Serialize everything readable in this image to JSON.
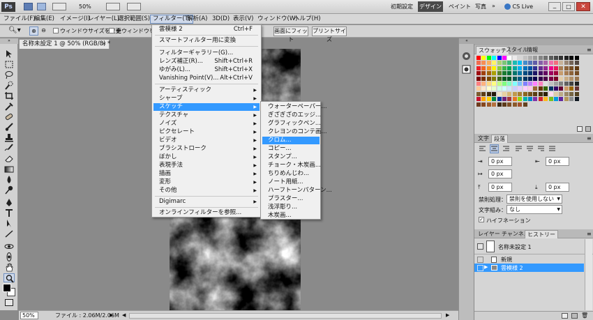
{
  "appbar": {
    "logo": "Ps",
    "zoom": "50%",
    "workspaces": [
      "初期設定",
      "デザイン",
      "ペイント",
      "写真"
    ],
    "active_workspace": "デザイン",
    "cs_live": "CS Live"
  },
  "menubar": {
    "items": [
      "ファイル(F)",
      "編集(E)",
      "イメージ(I)",
      "レイヤー(L)",
      "選択範囲(S)",
      "フィルター(T)",
      "解析(A)",
      "3D(D)",
      "表示(V)",
      "ウィンドウ(W)",
      "ヘルプ(H)"
    ],
    "active": "フィルター(T)"
  },
  "options": {
    "resize_windows": "ウィンドウサイズを変更",
    "all_windows": "全ウィンドウをズー",
    "fit_screen": "画面にフィット",
    "print_size": "プリントサイズ"
  },
  "document": {
    "tab_title": "名称未設定 1 @ 50% (RGB/8) *",
    "status_zoom": "50%",
    "status_info": "ファイル : 2.06M/2.06M"
  },
  "filter_menu": {
    "last_filter": "雲模様 2",
    "last_filter_shortcut": "Ctrl+F",
    "smart_filter": "スマートフィルター用に変換",
    "gallery": "フィルターギャラリー(G)...",
    "lens": "レンズ補正(R)...",
    "lens_shortcut": "Shift+Ctrl+R",
    "liquify": "ゆがみ(L)...",
    "liquify_shortcut": "Shift+Ctrl+X",
    "vanishing": "Vanishing Point(V)...",
    "vanishing_shortcut": "Alt+Ctrl+V",
    "submenus": [
      "アーティスティック",
      "シャープ",
      "スケッチ",
      "テクスチャ",
      "ノイズ",
      "ピクセレート",
      "ビデオ",
      "ブラシストローク",
      "ぼかし",
      "表現手法",
      "描画",
      "変形",
      "その他"
    ],
    "highlighted": "スケッチ",
    "digimarc": "Digimarc",
    "online": "オンラインフィルターを参照..."
  },
  "sketch_menu": {
    "items": [
      "ウォーターペーパー...",
      "ぎざぎざのエッジ...",
      "グラフィックペン...",
      "クレヨンのコンテ画...",
      "クロム...",
      "コピー...",
      "スタンプ...",
      "チョーク・木炭画...",
      "ちりめんじわ...",
      "ノート用紙...",
      "ハーフトーンパターン...",
      "プラスター...",
      "浅浮彫り...",
      "木炭画..."
    ],
    "highlighted": "クロム..."
  },
  "swatches_panel": {
    "tabs": [
      "スウォッチ",
      "スタイル",
      "情報"
    ],
    "active": "スウォッチ"
  },
  "paragraph_panel": {
    "tabs": [
      "文字",
      "段落"
    ],
    "active": "段落",
    "indent_left": "0 px",
    "indent_right": "0 px",
    "indent_first": "0 px",
    "space_before": "0 px",
    "space_after": "0 px",
    "kinsoku_label": "禁則処理：",
    "kinsoku_value": "禁則を使用しない",
    "mojikumi_label": "文字組み：",
    "mojikumi_value": "なし",
    "hyphenation": "ハイフネーション"
  },
  "history_panel": {
    "tabs": [
      "レイヤー",
      "チャンネル",
      "ヒストリー"
    ],
    "active": "ヒストリー",
    "snapshot": "名称未設定 1",
    "states": [
      "新規",
      "雲模様 2"
    ],
    "selected": "雲模様 2"
  },
  "colors": {
    "highlight": "#3399ff",
    "panel_bg": "#d5d5d5",
    "canvas_bg": "#8a8a8a"
  }
}
